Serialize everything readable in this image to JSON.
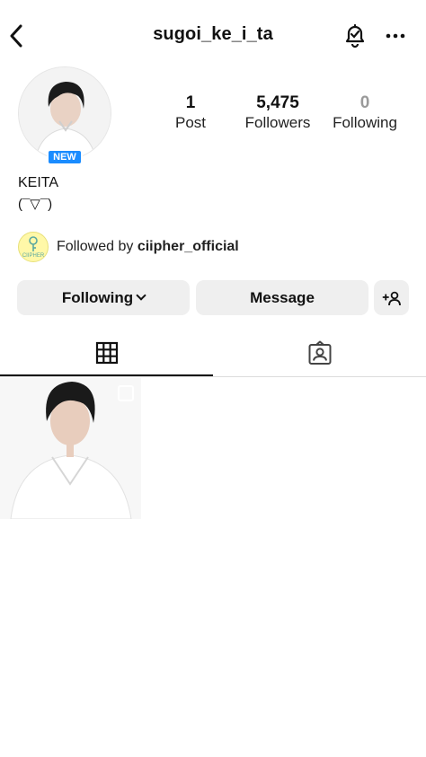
{
  "header": {
    "username": "sugoi_ke_i_ta",
    "icons": [
      "back-icon",
      "bell-check-icon",
      "more-icon"
    ]
  },
  "profile": {
    "badge": "NEW",
    "display_name": "KEITA",
    "bio": "(¯▽¯)"
  },
  "stats": {
    "posts": {
      "value": "1",
      "label": "Post"
    },
    "followers": {
      "value": "5,475",
      "label": "Followers"
    },
    "following": {
      "value": "0",
      "label": "Following"
    }
  },
  "mutual": {
    "prefix": "Followed by ",
    "account": "ciipher_official",
    "avatar_text": "CIIPHER"
  },
  "actions": {
    "following_label": "Following",
    "message_label": "Message",
    "add_icon": "add-person-icon"
  },
  "tabs": [
    "grid-icon",
    "tagged-icon"
  ],
  "colors": {
    "accent": "#1a8cff",
    "button_bg": "#efefef",
    "muted": "#9a9a9a"
  }
}
